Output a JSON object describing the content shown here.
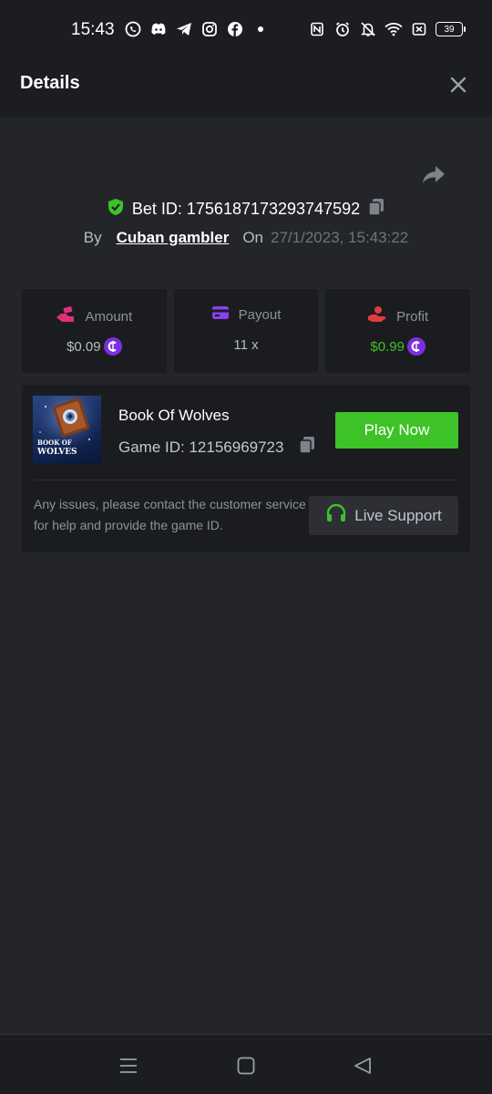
{
  "status_bar": {
    "time": "15:43",
    "left_icons": [
      "whatsapp-icon",
      "discord-icon",
      "telegram-icon",
      "instagram-icon",
      "facebook-icon",
      "dot-icon"
    ],
    "right_icons": [
      "nfc-icon",
      "alarm-icon",
      "mute-icon",
      "wifi-icon",
      "sim-icon"
    ],
    "battery": "39"
  },
  "header": {
    "title": "Details"
  },
  "bet": {
    "bet_id_label": "Bet ID: 1756187173293747592",
    "by_label": "By",
    "username": "Cuban gambler",
    "on_label": "On",
    "date": "27/1/2023, 15:43:22"
  },
  "stats": {
    "amount": {
      "label": "Amount",
      "value": "$0.09"
    },
    "payout": {
      "label": "Payout",
      "value": "11 x"
    },
    "profit": {
      "label": "Profit",
      "value": "$0.99"
    }
  },
  "game": {
    "name": "Book Of Wolves",
    "id_label": "Game ID: 12156969723",
    "thumb_text_1": "BOOK OF",
    "thumb_text_2": "WOLVES",
    "play_label": "Play Now",
    "help_text": "Any issues, please contact the customer service for help and provide the game ID.",
    "support_label": "Live Support"
  },
  "colors": {
    "accent_green": "#3dc227",
    "coin_purple": "#7b2fe0",
    "amount_icon": "#e0307a",
    "payout_icon": "#8a3ff0",
    "profit_icon": "#e23b3b"
  }
}
